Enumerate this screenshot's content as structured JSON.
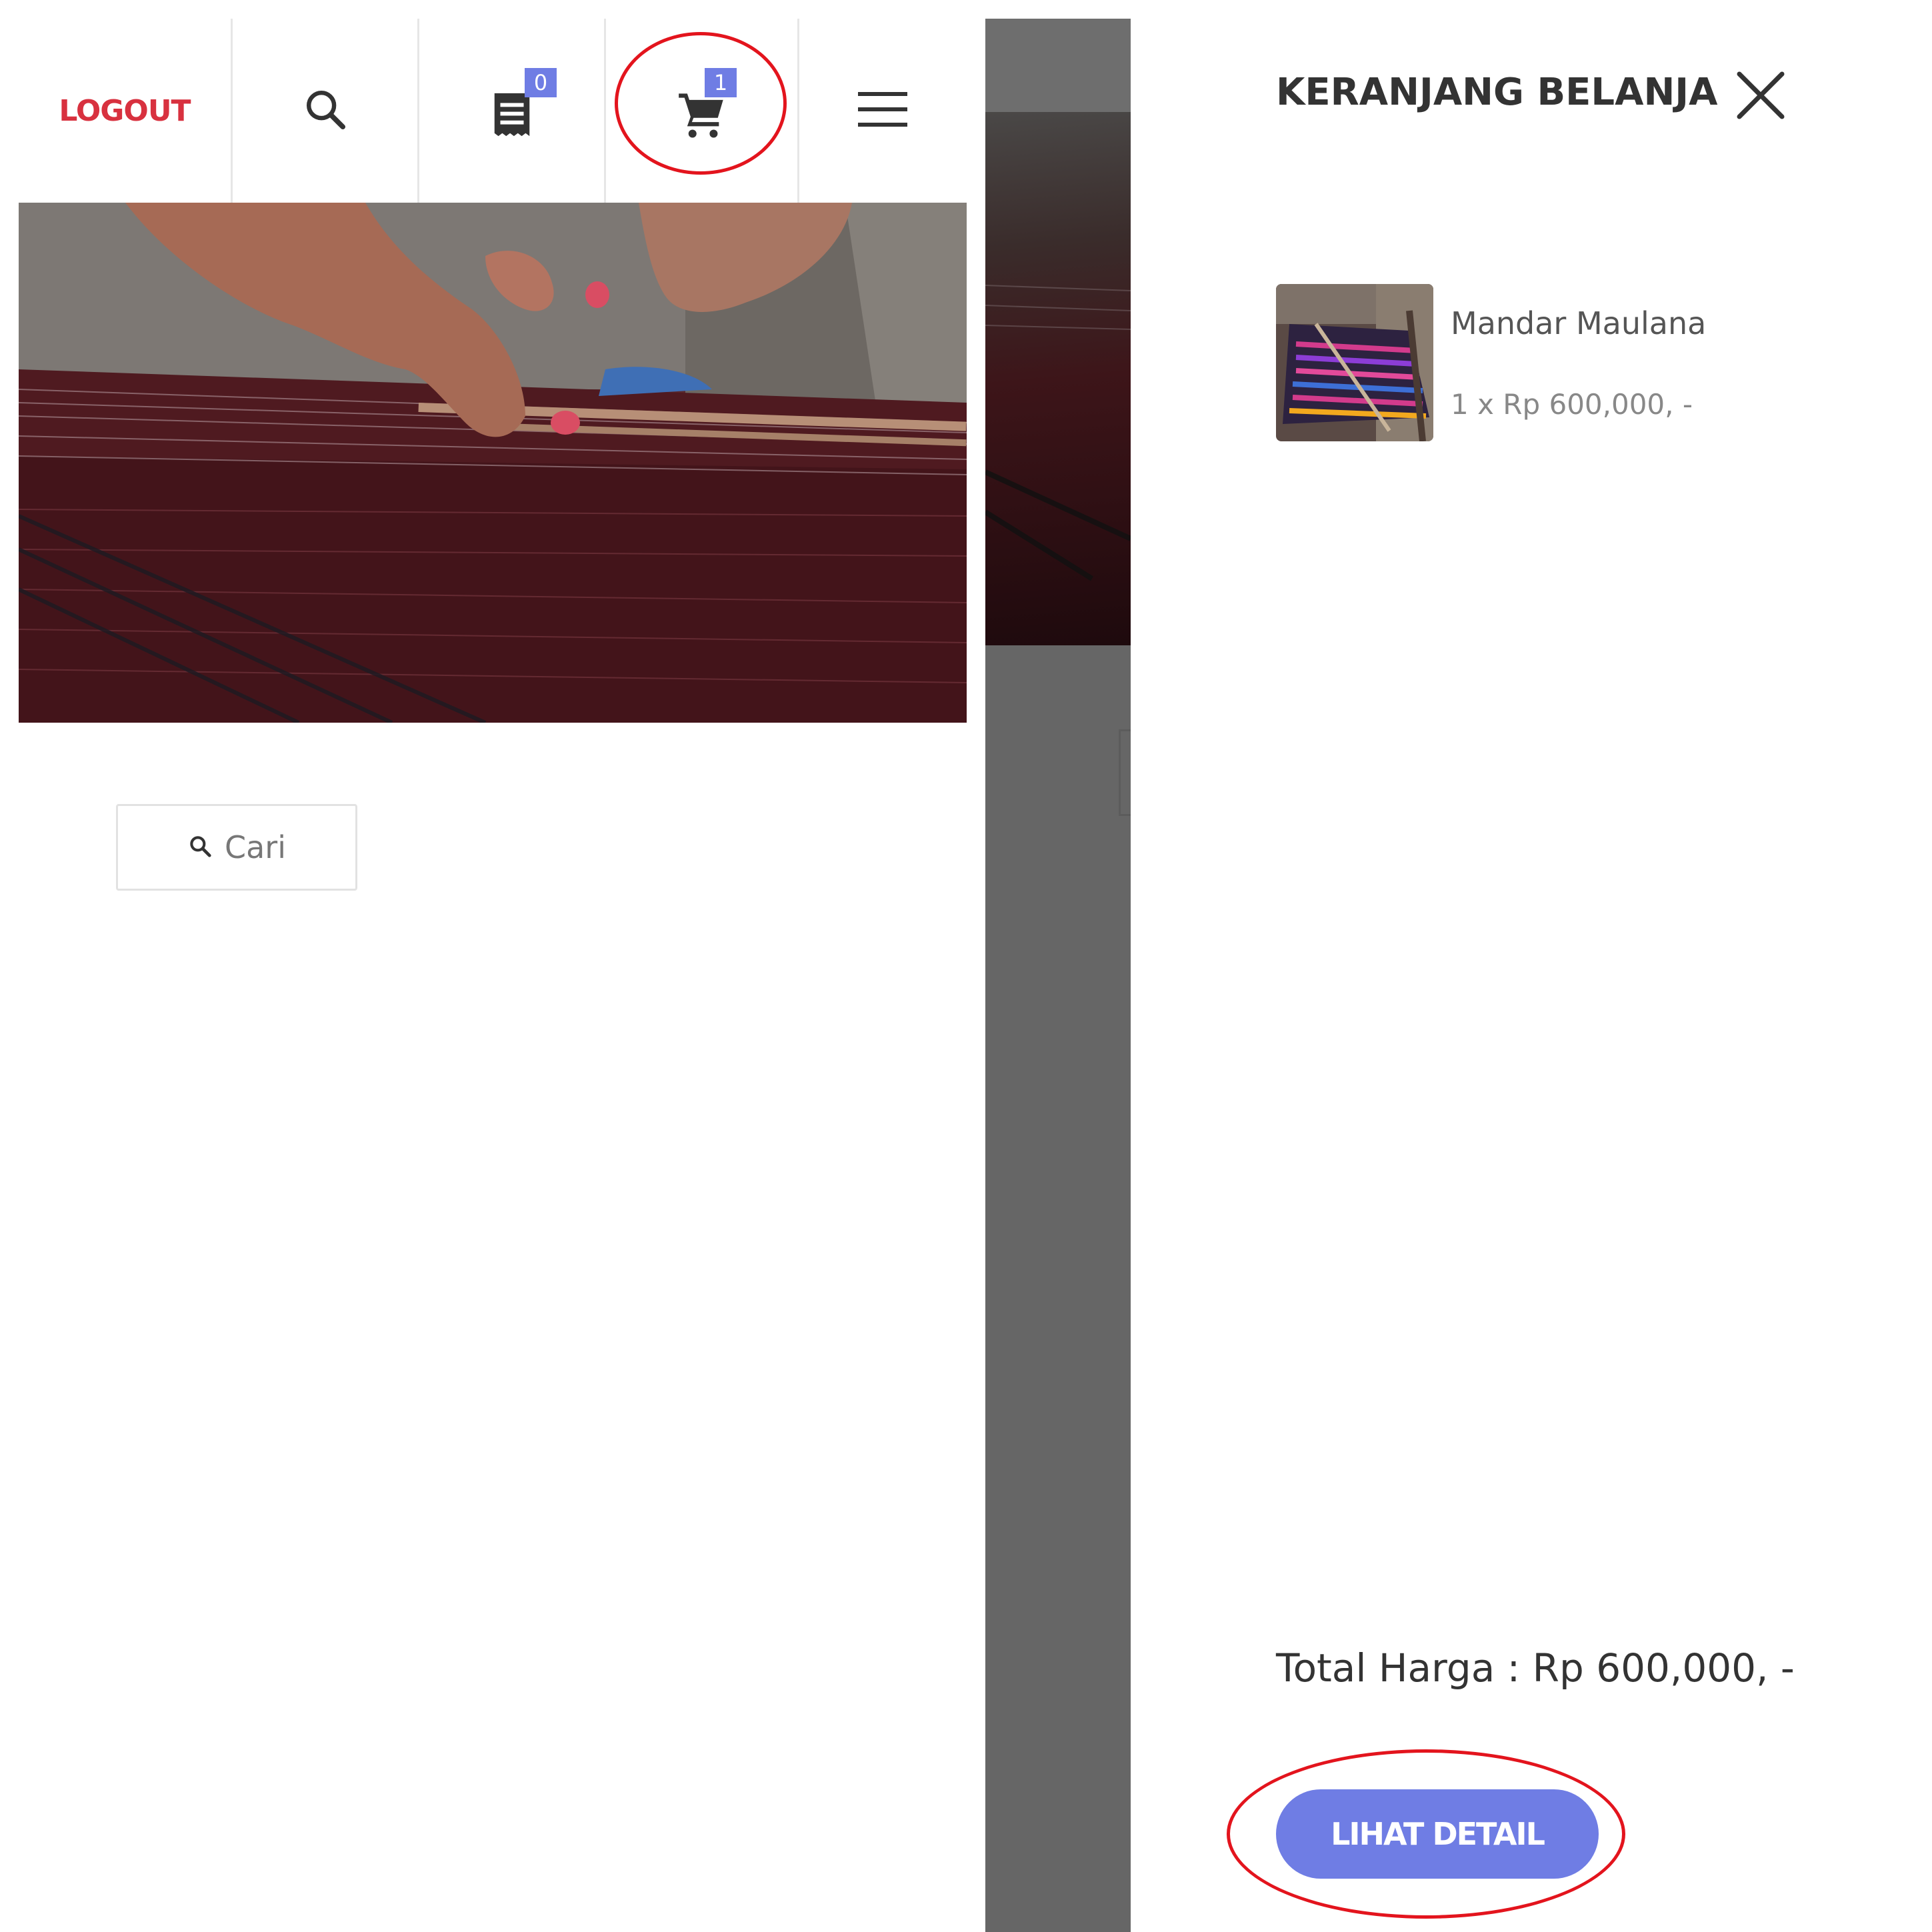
{
  "left_screen": {
    "header": {
      "logout_label": "LOGOUT",
      "icons": {
        "search": "search-icon",
        "orders": "receipt-icon",
        "cart": "cart-icon",
        "menu": "hamburger-menu-icon"
      },
      "orders_badge": "0",
      "cart_badge": "1"
    },
    "search_button_label": "Cari"
  },
  "cart_drawer": {
    "title": "KERANJANG BELANJA",
    "items": [
      {
        "name": "Mandar Maulana",
        "qty_price": "1 x Rp 600,000, -"
      }
    ],
    "total_label": "Total Harga : Rp 600,000, -",
    "detail_button_label": "LIHAT DETAIL"
  },
  "colors": {
    "accent": "#6f7de4",
    "logout_red": "#d8313f",
    "annotation_red": "#e3141d",
    "overlay_gray": "#666666"
  }
}
